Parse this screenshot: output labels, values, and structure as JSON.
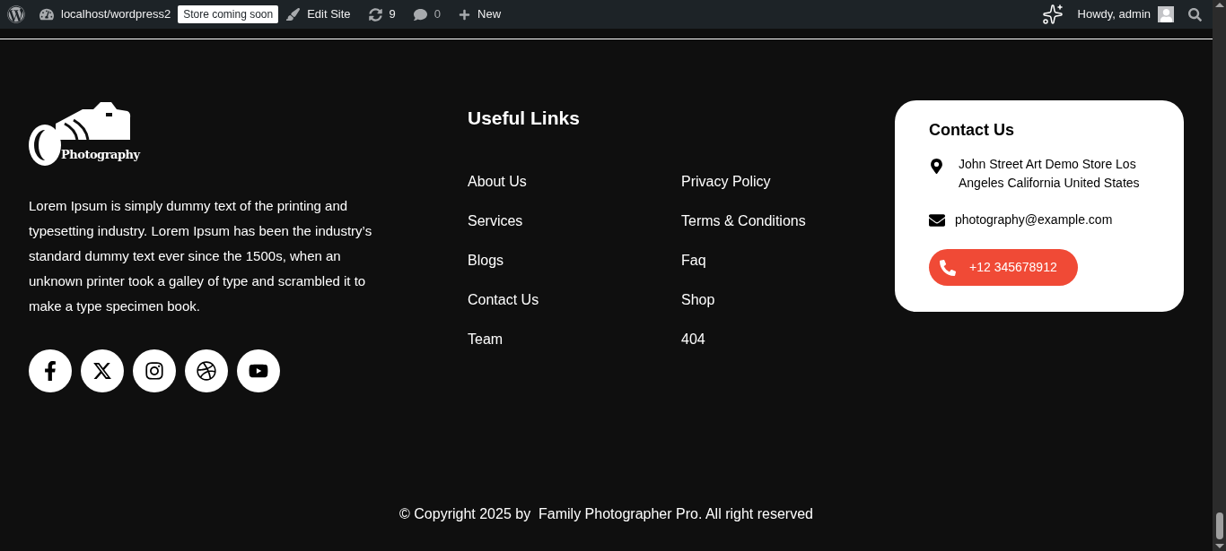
{
  "admin_bar": {
    "site": "localhost/wordpress2",
    "badge": "Store coming soon",
    "edit_site": "Edit Site",
    "updates": "9",
    "comments": "0",
    "new": "New",
    "greeting": "Howdy, admin"
  },
  "footer": {
    "logo_text": "Photography",
    "about": "Lorem Ipsum is simply dummy text of the printing and typesetting industry. Lorem Ipsum has been the industry’s standard dummy text ever since the 1500s, when an unknown printer took a galley of type and scrambled it to make a type specimen book.",
    "social": [
      {
        "kind": "facebook"
      },
      {
        "kind": "x"
      },
      {
        "kind": "instagram"
      },
      {
        "kind": "dribbble"
      },
      {
        "kind": "youtube"
      }
    ],
    "links_title": "Useful Links",
    "links": [
      [
        "About Us",
        "Services",
        "Blogs",
        "Contact Us",
        "Team"
      ],
      [
        "Privacy Policy",
        "Terms & Conditions",
        "Faq",
        "Shop",
        "404"
      ]
    ],
    "contact": {
      "title": "Contact Us",
      "address": "John Street Art Demo Store Los Angeles California United States",
      "email": "photography@example.com",
      "phone": "+12 345678912"
    },
    "copyright": "© Copyright 2025 by  Family Photographer Pro. All right reserved"
  }
}
